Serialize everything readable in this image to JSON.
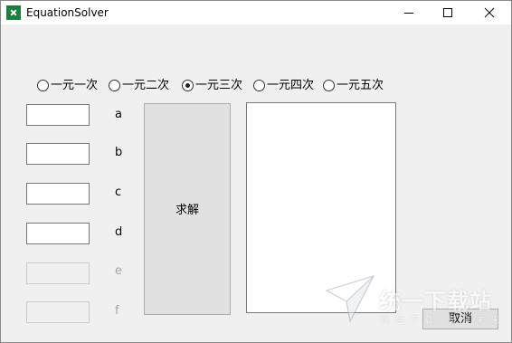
{
  "window": {
    "title": "EquationSolver",
    "icon": "excel-x-icon",
    "icon_color": "#1e7e3e"
  },
  "equation_types": [
    {
      "label": "一元一次",
      "checked": false
    },
    {
      "label": "一元二次",
      "checked": false
    },
    {
      "label": "一元三次",
      "checked": true
    },
    {
      "label": "一元四次",
      "checked": false
    },
    {
      "label": "一元五次",
      "checked": false
    }
  ],
  "coefficients": [
    {
      "label": "a",
      "value": "",
      "enabled": true
    },
    {
      "label": "b",
      "value": "",
      "enabled": true
    },
    {
      "label": "c",
      "value": "",
      "enabled": true
    },
    {
      "label": "d",
      "value": "",
      "enabled": true
    },
    {
      "label": "e",
      "value": "",
      "enabled": false
    },
    {
      "label": "f",
      "value": "",
      "enabled": false
    }
  ],
  "buttons": {
    "solve": "求解",
    "cancel": "取消"
  },
  "result": {
    "value": ""
  },
  "watermark": {
    "text": "统一下载站",
    "subtitle": "绿色下载·安全未来"
  }
}
